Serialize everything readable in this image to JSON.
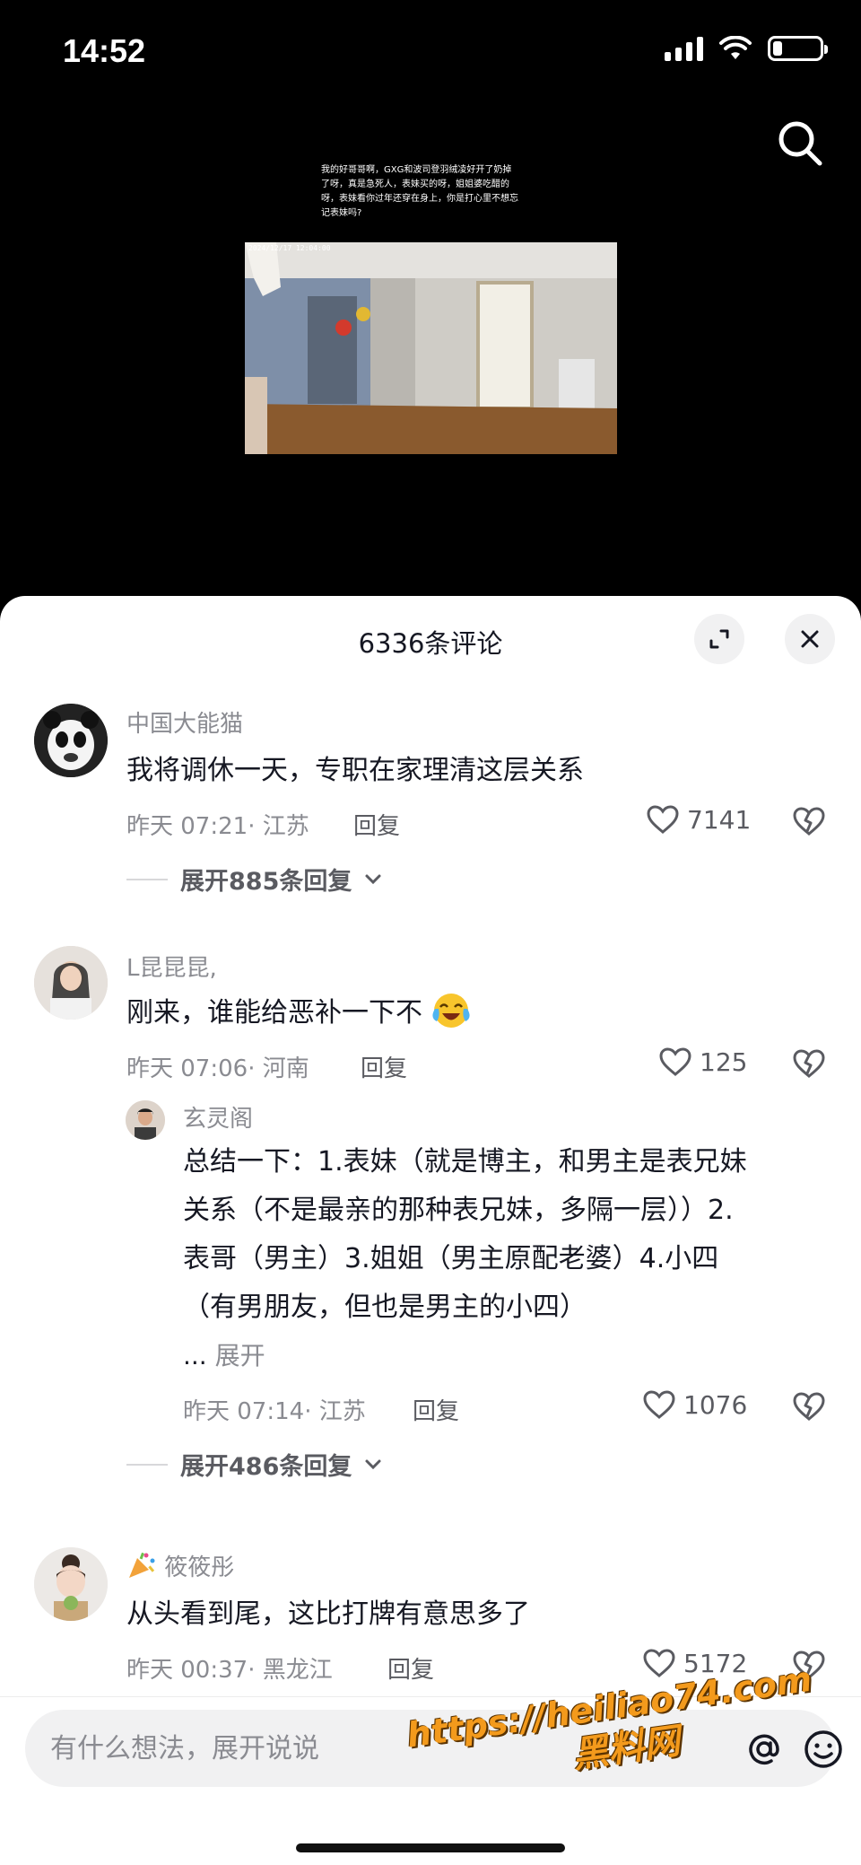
{
  "status_bar": {
    "time": "14:52",
    "battery_level": 0.2
  },
  "video": {
    "caption": "我的好哥哥啊，GXG和波司登羽绒凌好开了奶掉了呀，真是急死人，表妹买的呀，姐姐婆吃醋的呀，表妹看你过年还穿在身上，你是打心里不想忘记表妹吗?",
    "timestamp": "2024/12/17 12:04:00"
  },
  "sheet": {
    "title": "6336条评论"
  },
  "comments": [
    {
      "user": "中国大能猫",
      "text": "我将调休一天，专职在家理清这层关系",
      "time": "昨天 07:21",
      "location": "· 江苏",
      "reply_label": "回复",
      "likes": "7141",
      "expand_label": "展开885条回复"
    },
    {
      "user": "L昆昆昆,",
      "text": "刚来，谁能给恶补一下不",
      "time": "昨天 07:06",
      "location": "· 河南",
      "reply_label": "回复",
      "likes": "125",
      "reply": {
        "user": "玄灵阁",
        "lines": [
          "总结一下：1.表妹（就是博主，和男主是表兄妹",
          "关系（不是最亲的那种表兄妹，多隔一层））2.",
          "表哥（男主）3.姐姐（男主原配老婆）4.小四",
          "（有男朋友，但也是男主的小四）"
        ],
        "more_prefix": "...",
        "more_label": "展开",
        "time": "昨天 07:14",
        "location": "· 江苏",
        "reply_label": "回复",
        "likes": "1076"
      },
      "expand_label": "展开486条回复"
    },
    {
      "user": "筱筱彤",
      "text": "从头看到尾，这比打牌有意思多了",
      "time": "昨天 00:37",
      "location": "· 黑龙江",
      "reply_label": "回复",
      "likes": "5172"
    }
  ],
  "input": {
    "placeholder": "有什么想法，展开说说"
  },
  "watermark": {
    "line1": "https://heiliao74.com",
    "line2": "黑料网"
  },
  "colors": {
    "accent_text": "#161823",
    "muted_text": "#8a8b91",
    "sheet_bg": "#ffffff",
    "watermark": "#f39a1c"
  }
}
